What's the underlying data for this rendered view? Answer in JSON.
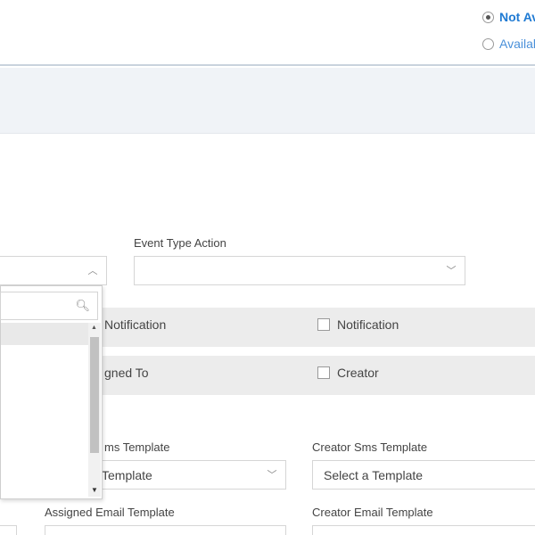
{
  "header": {
    "status_options": [
      {
        "label": "Not Av",
        "selected": true
      },
      {
        "label": "Availab",
        "selected": false
      }
    ]
  },
  "form": {
    "event_type_action_label": "Event Type Action",
    "event_type_action_value": "",
    "notification_row": {
      "left_label": "Notification",
      "right_label": "Notification"
    },
    "recipient_row": {
      "left_label": "gned To",
      "right_label": "Creator"
    },
    "sms_templates": {
      "assigned_label": "ms Template",
      "assigned_value": "Template",
      "creator_label": "Creator Sms Template",
      "creator_value": "Select a Template"
    },
    "email_templates": {
      "assigned_label": "Assigned Email Template",
      "creator_label": "Creator Email Template"
    }
  },
  "dropdown": {
    "search_value": "",
    "icons": {
      "search": "magnifier-icon",
      "up": "scroll-up-arrow-icon",
      "down": "scroll-down-arrow-icon"
    }
  },
  "colors": {
    "accent": "#1f7ad3",
    "band": "#ececec",
    "header_band": "#f0f3f7"
  }
}
